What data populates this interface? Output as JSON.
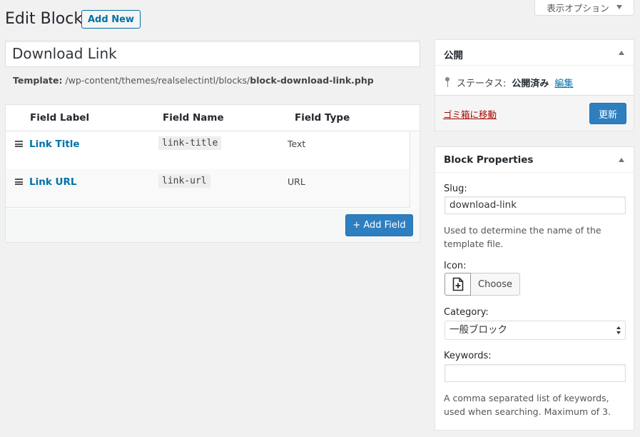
{
  "screen_options": {
    "label": "表示オプション"
  },
  "header": {
    "title": "Edit Block",
    "add_new_label": "Add New"
  },
  "title_input": {
    "value": "Download Link"
  },
  "template": {
    "label": "Template:",
    "path": "/wp-content/themes/realselectintl/blocks/",
    "file": "block-download-link.php"
  },
  "fields": {
    "columns": [
      "Field Label",
      "Field Name",
      "Field Type"
    ],
    "rows": [
      {
        "label": "Link Title",
        "name": "link-title",
        "type": "Text"
      },
      {
        "label": "Link URL",
        "name": "link-url",
        "type": "URL"
      }
    ],
    "add_field_label": "+ Add Field"
  },
  "publish": {
    "title": "公開",
    "status_label": "ステータス:",
    "status_value": "公開済み",
    "edit_label": "編集",
    "trash_label": "ゴミ箱に移動",
    "update_label": "更新"
  },
  "block_properties": {
    "title": "Block Properties",
    "slug_label": "Slug:",
    "slug_value": "download-link",
    "slug_desc": "Used to determine the name of the template file.",
    "icon_label": "Icon:",
    "choose_label": "Choose",
    "icon_name": "file-add-icon",
    "category_label": "Category:",
    "category_value": "一般ブロック",
    "keywords_label": "Keywords:",
    "keywords_value": "",
    "keywords_desc": "A comma separated list of keywords, used when searching. Maximum of 3."
  },
  "colors": {
    "primary": "#2e7fc0",
    "link": "#0073aa",
    "trash": "#aa0000"
  }
}
